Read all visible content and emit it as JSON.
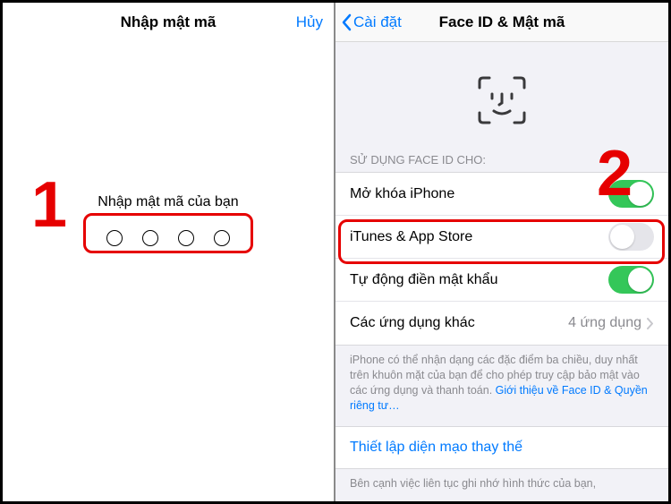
{
  "annotations": {
    "step1": "1",
    "step2": "2"
  },
  "left": {
    "title": "Nhập mật mã",
    "cancel": "Hủy",
    "prompt": "Nhập mật mã của bạn"
  },
  "right": {
    "back": "Cài đặt",
    "title": "Face ID & Mật mã",
    "sectionHeader": "SỬ DỤNG FACE ID CHO:",
    "rows": {
      "unlock": "Mở khóa iPhone",
      "itunes": "iTunes & App Store",
      "autofill": "Tự động điền mật khẩu",
      "other": "Các ứng dụng khác",
      "otherDetail": "4 ứng dụng"
    },
    "footer": "iPhone có thể nhận dạng các đặc điểm ba chiều, duy nhất trên khuôn mặt của bạn để cho phép truy cập bảo mật vào các ứng dụng và thanh toán. ",
    "footerLink": "Giới thiệu về Face ID & Quyền riêng tư…",
    "altAppearance": "Thiết lập diện mạo thay thế",
    "altFooter": "Bên cạnh việc liên tục ghi nhớ hình thức của bạn,"
  }
}
